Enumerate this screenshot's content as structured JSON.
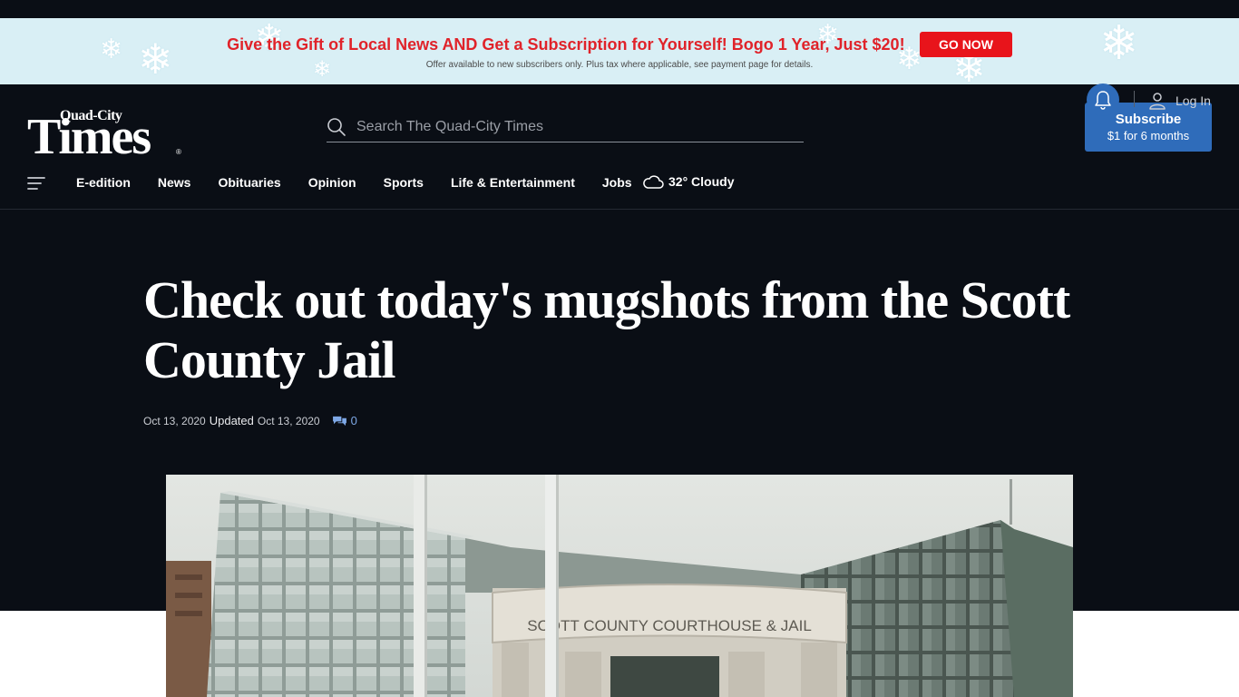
{
  "promo": {
    "headline": "Give the Gift of Local News AND Get a Subscription for Yourself! Bogo 1 Year, Just $20!",
    "button": "GO NOW",
    "fine_print": "Offer available to new subscribers only. Plus tax where applicable, see payment page for details.",
    "colors": {
      "background": "#d9eff5",
      "headline": "#e0232a",
      "button": "#e8141b"
    }
  },
  "logo": {
    "top": "Quad-City",
    "main": "Times",
    "reg": "®"
  },
  "search": {
    "placeholder": "Search The Quad-City Times"
  },
  "subscribe": {
    "title": "Subscribe",
    "offer": "$1 for 6 months",
    "color": "#2f6cba"
  },
  "nav": {
    "items": [
      "E-edition",
      "News",
      "Obituaries",
      "Opinion",
      "Sports",
      "Life & Entertainment",
      "Jobs"
    ],
    "weather": "32° Cloudy",
    "login": "Log In"
  },
  "article": {
    "headline": "Check out today's mugshots from the Scott County Jail",
    "date": "Oct 13, 2020",
    "updated_label": "Updated",
    "updated_date": "Oct 13, 2020",
    "comment_count": "0",
    "photo_sign": "SCOTT COUNTY COURTHOUSE & JAIL"
  },
  "icons": [
    "snowflake-icon",
    "search-icon",
    "menu-icon",
    "cloud-icon",
    "bell-icon",
    "user-icon",
    "comments-icon"
  ]
}
